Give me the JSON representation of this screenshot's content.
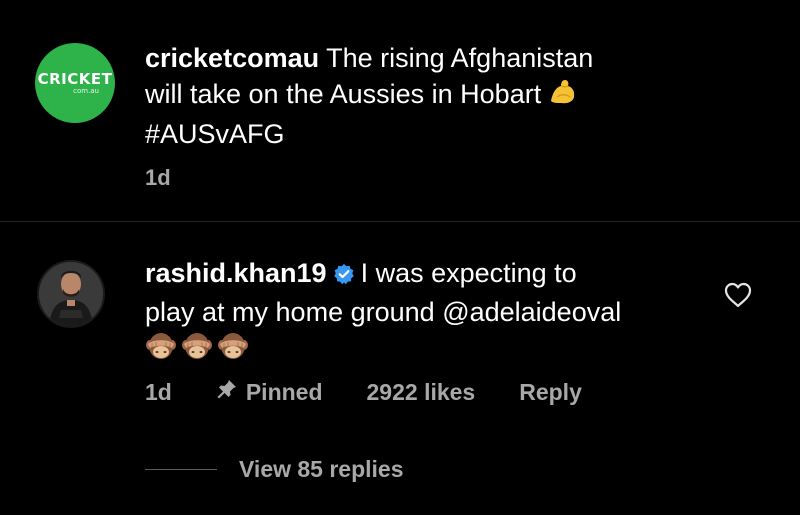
{
  "post": {
    "avatar_logo_text": "CRICKET",
    "avatar_logo_sub": "com.au",
    "username": "cricketcomau",
    "caption_line1": "The rising Afghanistan",
    "caption_line2": "will take on the Aussies in Hobart",
    "caption_emoji": "flexed-biceps-emoji",
    "hashtag": "#AUSvAFG",
    "time": "1d",
    "accent_color": "#2db34a"
  },
  "comment": {
    "username": "rashid.khan19",
    "verified": true,
    "text_line1": "I was expecting to",
    "text_line2": "play at my home ground",
    "mention": "@adelaideoval",
    "emojis": [
      "see-no-evil-monkey-emoji",
      "see-no-evil-monkey-emoji",
      "see-no-evil-monkey-emoji"
    ],
    "time": "1d",
    "pinned_label": "Pinned",
    "likes_label": "2922 likes",
    "reply_label": "Reply",
    "view_replies_label": "View 85 replies",
    "verified_color": "#3897f0"
  }
}
